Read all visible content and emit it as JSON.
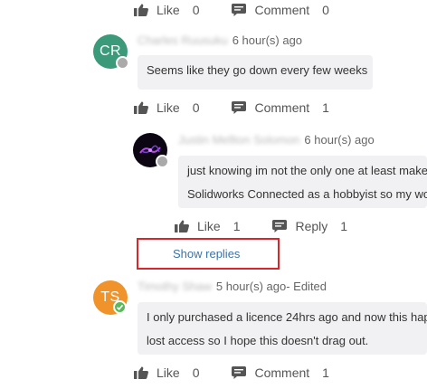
{
  "colors": {
    "accent_link": "#3d72a8",
    "highlight_border": "#d9262b",
    "bubble_bg": "#f1f1f3",
    "online": "#5cb85c",
    "offline": "#aaaaaa"
  },
  "icons": {
    "like": "thumbs-up-icon",
    "comment": "comment-icon",
    "reply": "reply-icon"
  },
  "top_actions": {
    "like_label": "Like",
    "like_count": "0",
    "comment_label": "Comment",
    "comment_count": "0"
  },
  "comments": [
    {
      "avatar_initials": "CR",
      "avatar_color": "#3a9a7a",
      "author": "Charles Ruusuku",
      "time": "6 hour(s) ago",
      "edited": "",
      "text_lines": [
        "Seems like they go down every few weeks"
      ],
      "actions": {
        "like_label": "Like",
        "like_count": "0",
        "comment_label": "Comment",
        "comment_count": "1"
      }
    },
    {
      "author": "Justin Mellton Solomon",
      "time": "6 hour(s) ago",
      "text_lines": [
        "just knowing im not the only one at least makes",
        "Solidworks Connected as a hobbyist so my wo"
      ],
      "actions": {
        "like_label": "Like",
        "like_count": "1",
        "reply_label": "Reply",
        "reply_count": "1"
      },
      "show_replies": "Show replies"
    },
    {
      "avatar_initials": "TS",
      "avatar_color": "#f0932b",
      "author": "Timothy Shaw",
      "time": "5 hour(s) ago",
      "edited": " - Edited",
      "text_lines": [
        "I only purchased a licence 24hrs ago and now this hap",
        "lost access so I hope this doesn't drag out."
      ],
      "actions": {
        "like_label": "Like",
        "like_count": "0",
        "comment_label": "Comment",
        "comment_count": "1"
      }
    }
  ]
}
